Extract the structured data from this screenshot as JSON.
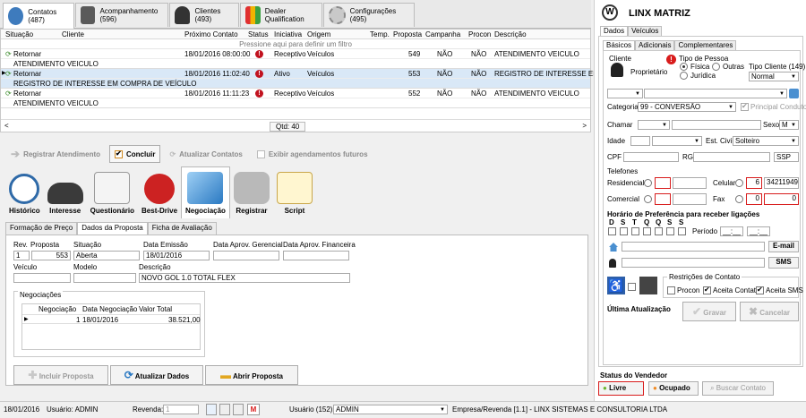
{
  "top_tabs": [
    {
      "label": "Contatos (487)"
    },
    {
      "label": "Acompanhamento (596)"
    },
    {
      "label": "Clientes (493)"
    },
    {
      "label": "Dealer Qualification"
    },
    {
      "label": "Configurações (495)"
    }
  ],
  "grid": {
    "headers": [
      "Situação",
      "Cliente",
      "Próximo Contato",
      "Status",
      "Iniciativa",
      "Origem",
      "Temp.",
      "Proposta",
      "Campanha",
      "Procon",
      "Descrição"
    ],
    "filter_hint": "Pressione aqui para definir um filtro",
    "rows": [
      {
        "situacao": "Retornar",
        "cliente": "",
        "proximo": "18/01/2016 08:00:00",
        "status_icon": "!",
        "iniciativa": "Receptivo",
        "origem": "Veículos",
        "temp": "",
        "proposta": "549",
        "campanha": "NÃO",
        "procon": "NÃO",
        "descricao": "ATENDIMENTO VEICULO",
        "sub": "ATENDIMENTO VEICULO"
      },
      {
        "situacao": "Retornar",
        "cliente": "",
        "proximo": "18/01/2016 11:02:40",
        "status_icon": "!",
        "iniciativa": "Ativo",
        "origem": "Veículos",
        "temp": "",
        "proposta": "553",
        "campanha": "NÃO",
        "procon": "NÃO",
        "descricao": "REGISTRO DE INTERESSE EM",
        "sub": "REGISTRO DE INTERESSE EM COMPRA DE VEÍCULO"
      },
      {
        "situacao": "Retornar",
        "cliente": "",
        "proximo": "18/01/2016 11:11:23",
        "status_icon": "!",
        "iniciativa": "Receptivo",
        "origem": "Veículos",
        "temp": "",
        "proposta": "552",
        "campanha": "NÃO",
        "procon": "NÃO",
        "descricao": "ATENDIMENTO VEICULO",
        "sub": "ATENDIMENTO VEICULO"
      }
    ],
    "qtd": "Qtd: 40"
  },
  "toolbar": {
    "registrar": "Registrar Atendimento",
    "concluir": "Concluir",
    "atualizar": "Atualizar Contatos",
    "exibir": "Exibir agendamentos futuros"
  },
  "big_tabs": [
    "Histórico",
    "Interesse",
    "Questionário",
    "Best-Drive",
    "Negociação",
    "Registrar",
    "Script"
  ],
  "proposal_tabs": [
    "Formação de Preço",
    "Dados da Proposta",
    "Ficha de Avaliação"
  ],
  "proposta": {
    "labels": {
      "rev": "Rev.",
      "proposta": "Proposta",
      "situacao": "Situação",
      "emissao": "Data Emissão",
      "aprov_ger": "Data Aprov. Gerencial",
      "aprov_fin": "Data Aprov. Financeira",
      "veiculo": "Veículo",
      "modelo": "Modelo",
      "descricao": "Descrição",
      "negociacoes": "Negociações"
    },
    "values": {
      "rev": "1",
      "proposta": "553",
      "situacao": "Aberta",
      "emissao": "18/01/2016",
      "descricao": "NOVO GOL 1.0 TOTAL FLEX"
    },
    "neg_headers": [
      "Negociação",
      "Data Negociação",
      "Valor Total"
    ],
    "neg_row": {
      "negociacao": "1",
      "data": "18/01/2016",
      "valor": "38.521,00"
    },
    "buttons": {
      "incluir": "Incluir Proposta",
      "atualizar": "Atualizar Dados",
      "abrir": "Abrir Proposta"
    }
  },
  "status_bar": {
    "date": "18/01/2016",
    "usuario": "Usuário: ADMIN",
    "revenda_label": "Revenda:",
    "revenda_value": "1",
    "usuario2_label": "Usuário (152):",
    "usuario2_value": "ADMIN",
    "empresa": "Empresa/Revenda [1.1] - LINX SISTEMAS E CONSULTORIA LTDA"
  },
  "right": {
    "title": "LINX MATRIZ",
    "tabs1": [
      "Dados",
      "Veículos"
    ],
    "tabs2": [
      "Básicos",
      "Adicionais",
      "Complementares"
    ],
    "cliente_label": "Cliente",
    "proprietario": "Proprietário",
    "tipo_pessoa": "Tipo de Pessoa",
    "fisica": "Física",
    "outras": "Outras",
    "juridica": "Jurídica",
    "tipo_cliente": "Tipo Cliente (149)",
    "tipo_cliente_value": "Normal",
    "categoria_label": "Categoria",
    "categoria_value": "99 - CONVERSÃO",
    "principal_condutor": "Principal Condutor",
    "chamar": "Chamar",
    "sexo": "Sexo",
    "sexo_value": "M",
    "idade": "Idade",
    "est_civil": "Est. Civil",
    "est_civil_value": "Solteiro",
    "cpf": "CPF",
    "rg": "RG",
    "ssp": "SSP",
    "telefones": "Telefones",
    "residencial": "Residencial",
    "celular": "Celular",
    "celular_ddd": "6",
    "celular_num": "34211949",
    "comercial": "Comercial",
    "fax": "Fax",
    "fax_ddd": "0",
    "fax_num": "0",
    "horario": "Horário de Preferência para receber ligações",
    "dias": [
      "D",
      "S",
      "T",
      "Q",
      "Q",
      "S",
      "S"
    ],
    "periodo": "Período",
    "periodo_from": "__:__",
    "periodo_to": "__:__",
    "email_btn": "E-mail",
    "sms_btn": "SMS",
    "restricoes": "Restrições de Contato",
    "procon": "Procon",
    "aceita_contato": "Aceita Contato",
    "aceita_sms": "Aceita SMS",
    "ultima_atualizacao": "Última Atualização",
    "gravar": "Gravar",
    "cancelar": "Cancelar",
    "status_vendedor": "Status do Vendedor",
    "livre": "Livre",
    "ocupado": "Ocupado",
    "buscar": "Buscar Contato"
  },
  "colors": {
    "accent_red": "#d81c1c",
    "status_green": "#6bb52f",
    "status_orange": "#f08a24",
    "selection": "#d9e8f7"
  }
}
